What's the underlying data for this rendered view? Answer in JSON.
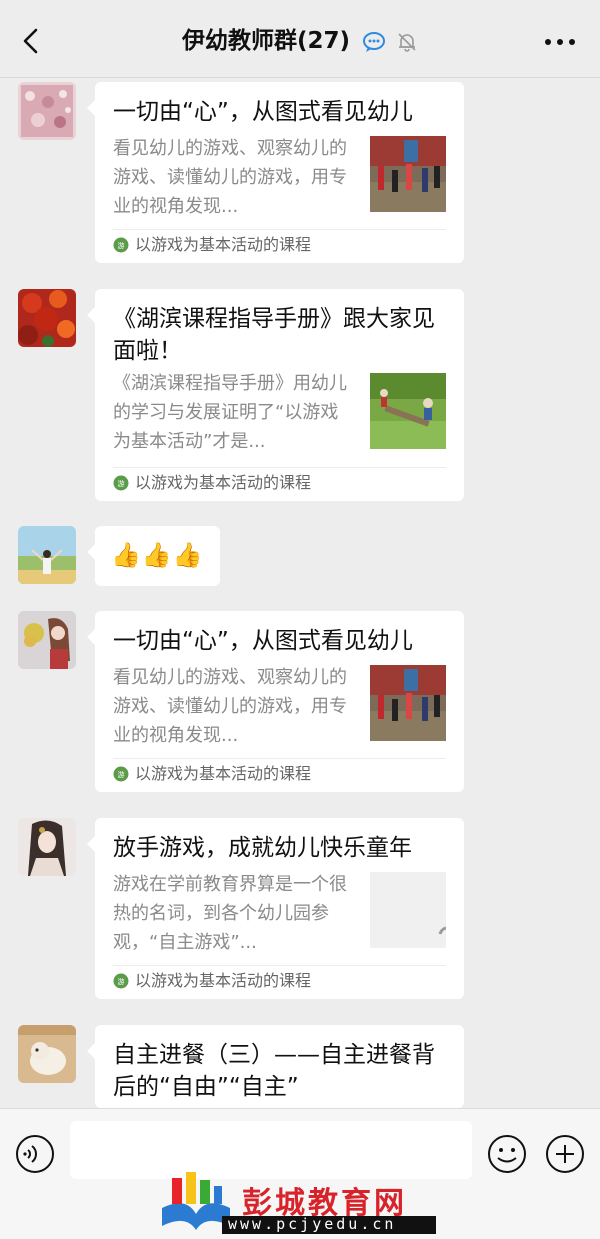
{
  "header": {
    "title": "伊幼教师群(27)"
  },
  "messages": [
    {
      "type": "article",
      "title": "一切由“心”，从图式看见幼儿",
      "desc": "看见幼儿的游戏、观察幼儿的游戏、读懂幼儿的游戏，用专业的视角发现...",
      "source": "以游戏为基本活动的课程"
    },
    {
      "type": "article",
      "title": "《湖滨课程指导手册》跟大家见面啦！",
      "desc": "《湖滨课程指导手册》用幼儿的学习与发展证明了“以游戏为基本活动”才是...",
      "source": "以游戏为基本活动的课程"
    },
    {
      "type": "emoji",
      "text": "👍👍👍"
    },
    {
      "type": "article",
      "title": "一切由“心”，从图式看见幼儿",
      "desc": "看见幼儿的游戏、观察幼儿的游戏、读懂幼儿的游戏，用专业的视角发现...",
      "source": "以游戏为基本活动的课程"
    },
    {
      "type": "article",
      "title": "放手游戏，成就幼儿快乐童年",
      "desc": "游戏在学前教育界算是一个很热的名词，到各个幼儿园参观，“自主游戏”...",
      "source": "以游戏为基本活动的课程"
    },
    {
      "type": "article",
      "title": "自主进餐（三）——自主进餐背后的“自由”“自主”"
    }
  ],
  "input": {
    "placeholder": ""
  },
  "watermark": {
    "name": "彭城教育网",
    "url": "www.pcjyedu.cn"
  },
  "colors": {
    "background": "#ededed",
    "bubble": "#ffffff",
    "muted_text": "#8a8a8a",
    "watermark_red": "#d8232a"
  }
}
